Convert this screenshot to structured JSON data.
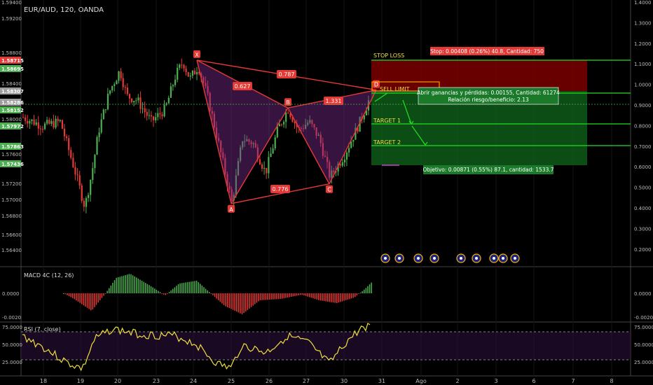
{
  "header": {
    "symbol_title": "EUR/AUD, 120, OANDA"
  },
  "chart_data": {
    "type": "candlestick",
    "title": "EUR/AUD, 120, OANDA",
    "price_axis_left": {
      "ticks": [
        "1.59400",
        "1.59200",
        "1.58800",
        "1.58400",
        "1.58000",
        "1.57600",
        "1.57200",
        "1.56800",
        "1.56400",
        "1.57000",
        "1.56600"
      ],
      "ylim": [
        1.563,
        1.594
      ],
      "highlighted_labels": [
        {
          "text": "1.58715",
          "bg": "#e53935"
        },
        {
          "text": "1.58695",
          "bg": "#4caf50"
        },
        {
          "text": "1.58307",
          "bg": "#9e9e9e"
        },
        {
          "text": "1.58286",
          "bg": "#9e9e9e"
        },
        {
          "text": "1.58152",
          "bg": "#4caf50"
        },
        {
          "text": "1.57972",
          "bg": "#4caf50"
        },
        {
          "text": "1.57863",
          "bg": "#4caf50"
        },
        {
          "text": "1.57436",
          "bg": "#4caf50"
        }
      ]
    },
    "percent_axis_right": {
      "ticks": [
        "1.4000",
        "1.3000",
        "1.2000",
        "1.1000",
        "1.0000",
        "0.9000",
        "0.8000",
        "0.7000",
        "0.6000",
        "0.5000",
        "0.4000",
        "0.3000",
        "0.2000"
      ]
    },
    "x_axis": {
      "ticks": [
        "18",
        "19",
        "20",
        "23",
        "24",
        "25",
        "26",
        "27",
        "30",
        "31",
        "Ago",
        "2",
        "3",
        "6",
        "7",
        "8"
      ]
    },
    "pattern": {
      "points": [
        {
          "label": "X",
          "price": 1.5872
        },
        {
          "label": "A",
          "price": 1.5704
        },
        {
          "label": "B",
          "price": 1.5816
        },
        {
          "label": "C",
          "price": 1.5727
        },
        {
          "label": "D",
          "price": 1.5837
        }
      ],
      "ratios": [
        "0.627",
        "0.787",
        "1.331",
        "0.776"
      ]
    },
    "trade": {
      "stop_loss_label": "STOP LOSS",
      "sell_limit_label": "SELL LIMIT",
      "target1_label": "TARGET 1",
      "target2_label": "TARGET 2",
      "stop_info": "Stop: 0.00408 (0.26%) 40.8, Cantidad: 750",
      "pnl_info": "Abrir ganancias y pérdidas: 0.00155, Cantidad: 61274",
      "rr_info": "Relación riesgo/beneficio: 2.13",
      "target_info": "Objetivo: 0.00871 (0.55%) 87.1, cantidad: 1533.7"
    },
    "macd": {
      "label": "MACD 4C (12, 26)",
      "ticks": [
        "0.0000",
        "-0.0020"
      ],
      "colors": {
        "up": "#4caf50",
        "down": "#e53935"
      }
    },
    "rsi": {
      "label": "RSI (7, close)",
      "ticks": [
        "75.0000",
        "50.0000",
        "25.0000"
      ],
      "levels": [
        70,
        30
      ],
      "line_color": "#f0e040"
    },
    "colors": {
      "up": "#4caf50",
      "down": "#e53935",
      "pattern_fill": "#7b2d8b",
      "stop_zone": "#8b0000",
      "target_zone": "#0e5a1a",
      "annotation_line": "#22dd22"
    }
  }
}
